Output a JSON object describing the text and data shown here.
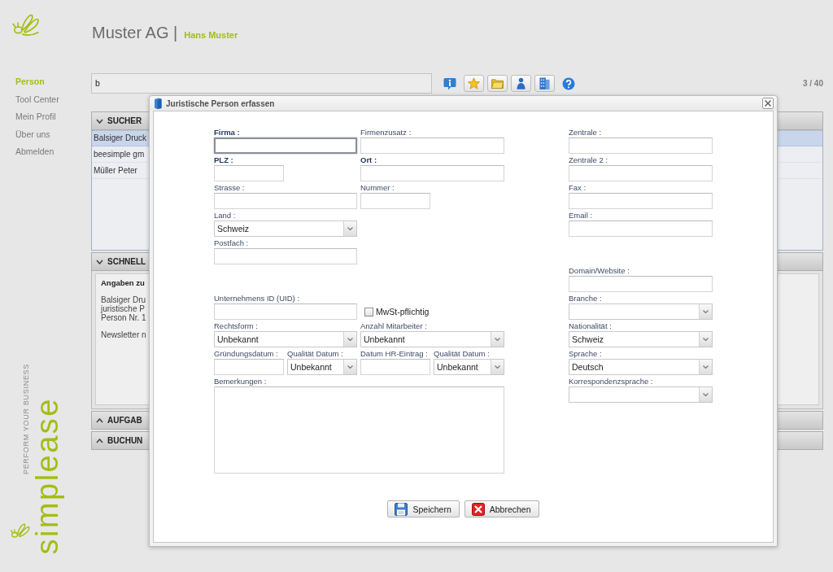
{
  "header": {
    "company": "Muster AG |",
    "user": "Hans Muster"
  },
  "nav": [
    {
      "label": "Person",
      "selected": true
    },
    {
      "label": "Tool Center",
      "selected": false
    },
    {
      "label": "Mein Profil",
      "selected": false
    },
    {
      "label": "Über uns",
      "selected": false
    },
    {
      "label": "Abmelden",
      "selected": false
    }
  ],
  "brand": {
    "name": "simplease",
    "tagline": "PERFORM YOUR BUSINESS"
  },
  "search": {
    "value": "b"
  },
  "pager": "3 / 40",
  "panels": [
    {
      "title": "SUCHER",
      "expanded": true,
      "rows": [
        {
          "text": "Balsiger Druck",
          "selected": true
        },
        {
          "text": "beesimple gm",
          "selected": false
        },
        {
          "text": "Müller Peter",
          "selected": false
        }
      ]
    },
    {
      "title": "SCHNELL",
      "expanded": true,
      "card": {
        "heading": "Angaben zu",
        "lines": [
          "Balsiger Dru",
          "juristische P",
          "Person Nr. 1"
        ],
        "note": "Newsletter n"
      }
    },
    {
      "title": "AUFGAB",
      "expanded": false
    },
    {
      "title": "BUCHUN",
      "expanded": false
    }
  ],
  "dialog": {
    "title": "Juristische Person erfassen",
    "left_sections": [
      [
        [
          {
            "kind": "text",
            "label": "Firma :",
            "required": true,
            "focused": true
          },
          {
            "kind": "text",
            "label": "Firmenzusatz :",
            "required": false,
            "focused": false
          }
        ],
        [
          {
            "kind": "text",
            "label": "PLZ :",
            "required": true,
            "focused": false
          },
          {
            "kind": "text",
            "label": "Ort :",
            "required": true,
            "focused": false
          }
        ],
        [
          {
            "kind": "text",
            "label": "Strasse :",
            "required": false,
            "focused": false
          },
          {
            "kind": "text",
            "label": "Nummer :",
            "required": false,
            "focused": false
          }
        ],
        [
          {
            "kind": "select",
            "label": "Land :",
            "required": false,
            "focused": false,
            "value": "Schweiz"
          }
        ],
        [
          {
            "kind": "text",
            "label": "Postfach :",
            "required": false,
            "focused": false
          }
        ]
      ],
      [
        [
          {
            "kind": "text",
            "label": "Unternehmens ID (UID) :",
            "required": false,
            "focused": false
          },
          {
            "kind": "checkbox",
            "label": "MwSt-pflichtig",
            "checked": false
          }
        ],
        [
          {
            "kind": "select",
            "label": "Rechtsform :",
            "required": false,
            "focused": false,
            "value": "Unbekannt"
          },
          {
            "kind": "select",
            "label": "Anzahl Mitarbeiter :",
            "required": false,
            "focused": false,
            "value": "Unbekannt"
          }
        ],
        [
          {
            "kind": "text",
            "label": "Gründungsdatum :",
            "required": false,
            "focused": false
          },
          {
            "kind": "select",
            "label": "Qualität Datum :",
            "required": false,
            "focused": false,
            "value": "Unbekannt"
          },
          {
            "kind": "text",
            "label": "Datum HR-Eintrag :",
            "required": false,
            "focused": false
          },
          {
            "kind": "select",
            "label": "Qualität Datum :",
            "required": false,
            "focused": false,
            "value": "Unbekannt"
          }
        ],
        [
          {
            "kind": "textarea",
            "label": "Bemerkungen :",
            "required": false,
            "focused": false
          }
        ]
      ]
    ],
    "right_sections": [
      [
        {
          "kind": "text",
          "label": "Zentrale :",
          "required": false,
          "focused": false
        },
        {
          "kind": "text",
          "label": "Zentrale 2 :",
          "required": false,
          "focused": false
        },
        {
          "kind": "text",
          "label": "Fax :",
          "required": false,
          "focused": false
        },
        {
          "kind": "text",
          "label": "Email :",
          "required": false,
          "focused": false
        }
      ],
      [
        {
          "kind": "text",
          "label": "Domain/Website :",
          "required": false,
          "focused": false
        },
        {
          "kind": "select",
          "label": "Branche :",
          "required": false,
          "focused": false
        },
        {
          "kind": "select",
          "label": "Nationalität :",
          "required": false,
          "focused": false,
          "value": "Schweiz"
        },
        {
          "kind": "select",
          "label": "Sprache :",
          "required": false,
          "focused": false,
          "value": "Deutsch"
        },
        {
          "kind": "select",
          "label": "Korrespondenzsprache :",
          "required": false,
          "focused": false
        }
      ]
    ],
    "buttons": [
      {
        "kind": "save",
        "label": "Speichern"
      },
      {
        "kind": "cancel",
        "label": "Abbrechen"
      }
    ]
  }
}
